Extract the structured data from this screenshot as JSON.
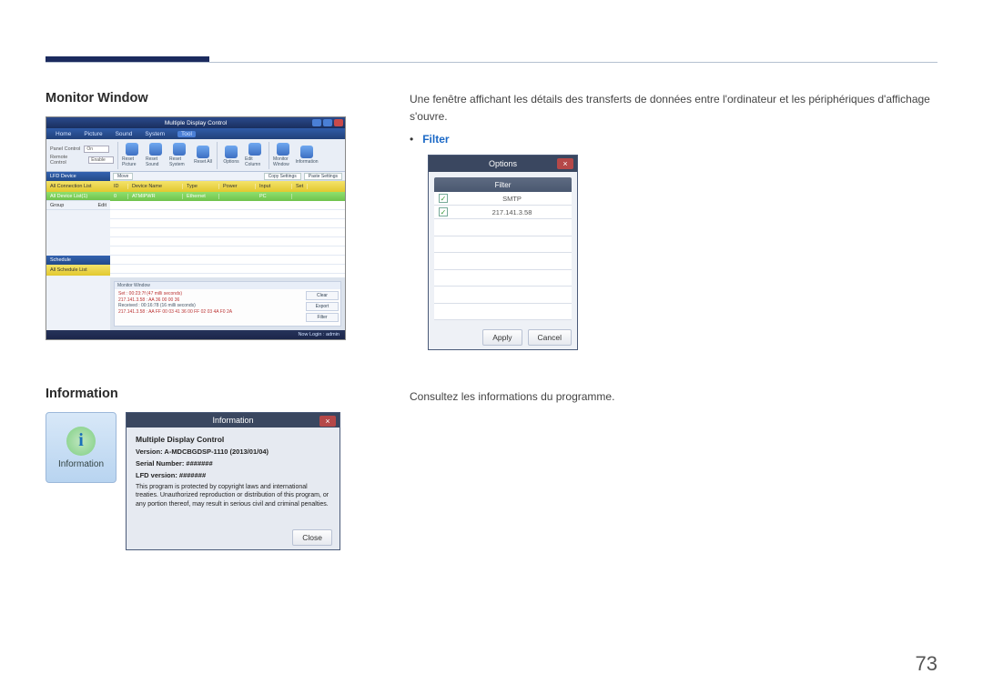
{
  "page_number": "73",
  "section1_title": "Monitor Window",
  "section2_title": "Information",
  "text_monitor_window_desc": "Une fenêtre affichant les détails des transferts de données entre l'ordinateur et les périphériques d'affichage s'ouvre.",
  "filter_label": "Filter",
  "text_information_desc": "Consultez les informations du programme.",
  "mdc": {
    "title": "Multiple Display Control",
    "menu": [
      "Home",
      "Picture",
      "Sound",
      "System",
      "Tool"
    ],
    "toolbar_left": {
      "panel_control_label": "Panel Control",
      "panel_control_value": "On",
      "remote_control_label": "Remote Control",
      "remote_control_value": "Enable"
    },
    "toolbar_icons": [
      "Reset Picture",
      "Reset Sound",
      "Reset System",
      "Reset All",
      "Options",
      "Edit Column",
      "Monitor Window",
      "Information"
    ],
    "grid_buttons": [
      "Move",
      "Copy Settings",
      "Paste Settings"
    ],
    "side": {
      "header1": "LFD Device",
      "yellow": "All Connection List",
      "item1": "All Device List(1)",
      "group": "Group",
      "edit": "Edit",
      "header2": "Schedule",
      "yellow2": "All Schedule List"
    },
    "grid_cols": [
      "ID",
      "Device Name",
      "Type",
      "Power",
      "Input",
      "Set"
    ],
    "grid_row1": [
      "0",
      "ATMIPWR",
      "Ethernet",
      "",
      "PC",
      ""
    ],
    "monitor_window": {
      "title": "Monitor Window",
      "line1": "Set : 00:23:7f (47 milli seconds)",
      "line2": "217.141.3.58 : AA 36 00 00 36",
      "line3": "Received : 00:16:78 (16 milli seconds)",
      "line4": "217.141.3.58 : AA FF 00 03 41 36 00 FF 02 03 4A F0 2A",
      "btns": [
        "Clear",
        "Export",
        "Filter"
      ]
    },
    "status": "Now Login : admin"
  },
  "options_dialog": {
    "title": "Options",
    "filter_header": "Filter",
    "rows": [
      "SMTP",
      "217.141.3.58"
    ],
    "apply": "Apply",
    "cancel": "Cancel"
  },
  "info_tile_label": "Information",
  "info_dialog": {
    "title": "Information",
    "product": "Multiple Display Control",
    "version": "Version: A-MDCBGDSP-1110 (2013/01/04)",
    "serial": "Serial Number: #######",
    "lfd": "LFD version: #######",
    "note": "This program is protected by copyright laws and international treaties. Unauthorized reproduction or distribution of this program, or any portion thereof, may result in serious civil and criminal penalties.",
    "close": "Close"
  }
}
